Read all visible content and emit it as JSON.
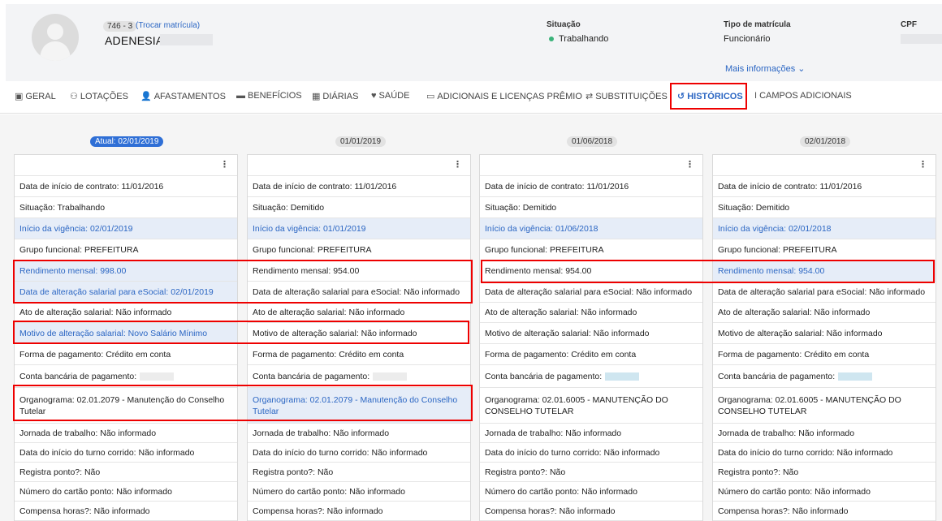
{
  "header": {
    "matricula_code": "746 - 3",
    "matricula_link": "(Trocar matrícula)",
    "employee_name": "ADENESIA",
    "situacao_label": "Situação",
    "situacao_value": "Trabalhando",
    "tipo_label": "Tipo de matrícula",
    "tipo_value": "Funcionário",
    "cpf_label": "CPF",
    "more_info": "Mais informações ⌄"
  },
  "tabs": [
    {
      "label": "GERAL",
      "icon": "id-card-icon"
    },
    {
      "label": "LOTAÇÕES",
      "icon": "sitemap-icon"
    },
    {
      "label": "AFASTAMENTOS",
      "icon": "user-x-icon"
    },
    {
      "label": "BENEFÍCIOS",
      "icon": "credit-card-icon"
    },
    {
      "label": "DIÁRIAS",
      "icon": "building-icon"
    },
    {
      "label": "SAÚDE",
      "icon": "heart-icon"
    },
    {
      "label": "ADICIONAIS E LICENÇAS PRÊMIO",
      "icon": "money-icon"
    },
    {
      "label": "SUBSTITUIÇÕES",
      "icon": "swap-icon"
    },
    {
      "label": "HISTÓRICOS",
      "icon": "history-icon"
    },
    {
      "label": "CAMPOS ADICIONAIS",
      "icon": "text-cursor-icon"
    }
  ],
  "active_tab": "HISTÓRICOS",
  "columns": [
    {
      "date": "Atual: 02/01/2019",
      "rows": [
        "Data de início de contrato: 11/01/2016",
        "Situação: Trabalhando",
        "Início da vigência: 02/01/2019",
        "Grupo funcional: PREFEITURA",
        "Rendimento mensal: 998.00",
        "Data de alteração salarial para eSocial: 02/01/2019",
        "Ato de alteração salarial: Não informado",
        "Motivo de alteração salarial: Novo Salário Mínimo",
        "Forma de pagamento: Crédito em conta",
        "Conta bancária de pagamento:",
        "Organograma: 02.01.2079 - Manutenção do Conselho Tutelar",
        "Jornada de trabalho: Não informado",
        "Data do início do turno corrido: Não informado",
        "Registra ponto?: Não",
        "Número do cartão ponto: Não informado",
        "Compensa horas?: Não informado"
      ]
    },
    {
      "date": "01/01/2019",
      "rows": [
        "Data de início de contrato: 11/01/2016",
        "Situação: Demitido",
        "Início da vigência: 01/01/2019",
        "Grupo funcional: PREFEITURA",
        "Rendimento mensal: 954.00",
        "Data de alteração salarial para eSocial: Não informado",
        "Ato de alteração salarial: Não informado",
        "Motivo de alteração salarial: Não informado",
        "Forma de pagamento: Crédito em conta",
        "Conta bancária de pagamento:",
        "Organograma: 02.01.2079 - Manutenção do Conselho Tutelar",
        "Jornada de trabalho: Não informado",
        "Data do início do turno corrido: Não informado",
        "Registra ponto?: Não",
        "Número do cartão ponto: Não informado",
        "Compensa horas?: Não informado"
      ]
    },
    {
      "date": "01/06/2018",
      "rows": [
        "Data de início de contrato: 11/01/2016",
        "Situação: Demitido",
        "Início da vigência: 01/06/2018",
        "Grupo funcional: PREFEITURA",
        "Rendimento mensal: 954.00",
        "Data de alteração salarial para eSocial: Não informado",
        "Ato de alteração salarial: Não informado",
        "Motivo de alteração salarial: Não informado",
        "Forma de pagamento: Crédito em conta",
        "Conta bancária de pagamento:",
        "Organograma: 02.01.6005 - MANUTENÇÃO DO CONSELHO TUTELAR",
        "Jornada de trabalho: Não informado",
        "Data do início do turno corrido: Não informado",
        "Registra ponto?: Não",
        "Número do cartão ponto: Não informado",
        "Compensa horas?: Não informado"
      ]
    },
    {
      "date": "02/01/2018",
      "rows": [
        "Data de início de contrato: 11/01/2016",
        "Situação: Demitido",
        "Início da vigência: 02/01/2018",
        "Grupo funcional: PREFEITURA",
        "Rendimento mensal: 954.00",
        "Data de alteração salarial para eSocial: Não informado",
        "Ato de alteração salarial: Não informado",
        "Motivo de alteração salarial: Não informado",
        "Forma de pagamento: Crédito em conta",
        "Conta bancária de pagamento:",
        "Organograma: 02.01.6005 - MANUTENÇÃO DO CONSELHO TUTELAR",
        "Jornada de trabalho: Não informado",
        "Data do início do turno corrido: Não informado",
        "Registra ponto?: Não",
        "Número do cartão ponto: Não informado",
        "Compensa horas?: Não informado"
      ]
    }
  ],
  "colors": {
    "accent": "#2b66c3",
    "highlight_bg": "#e6edf8",
    "annotation": "#ee0000",
    "status_ok": "#3bb37a"
  },
  "kebab_icon": "⋮"
}
